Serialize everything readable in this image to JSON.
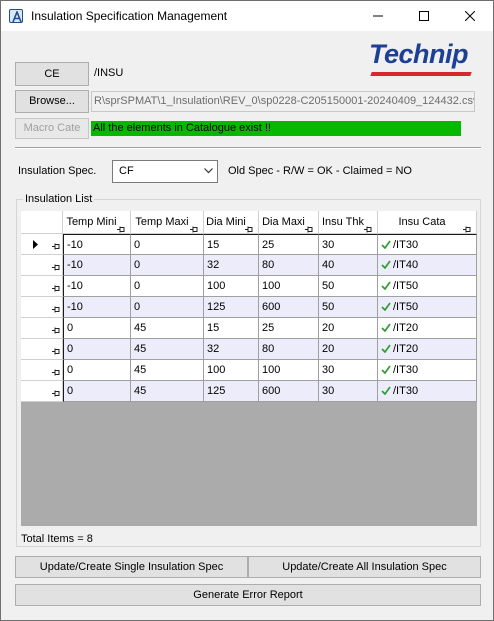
{
  "window": {
    "title": "Insulation Specification Management"
  },
  "buttons": {
    "ce": "CE",
    "browse": "Browse...",
    "macro": "Macro Cate",
    "update_single": "Update/Create Single Insulation Spec",
    "update_all": "Update/Create All Insulation Spec",
    "error_report": "Generate Error Report"
  },
  "ce_value": "/INSU",
  "file_path": "R\\sprSPMAT\\1_Insulation\\REV_0\\sp0228-C205150001-20240409_124432.csv",
  "status_message": "All the elements in Catalogue exist !!",
  "status_color": "#06b800",
  "logo_text": "Technip",
  "insulation_spec": {
    "label": "Insulation Spec.",
    "selected": "CF",
    "info": "Old Spec - R/W = OK - Claimed = NO"
  },
  "list": {
    "title": "Insulation List",
    "columns": [
      "Temp Mini",
      "Temp Maxi",
      "Dia Mini",
      "Dia Maxi",
      "Insu Thk",
      "Insu Cata"
    ],
    "rows": [
      [
        "-10",
        "0",
        "15",
        "25",
        "30",
        "/IT30"
      ],
      [
        "-10",
        "0",
        "32",
        "80",
        "40",
        "/IT40"
      ],
      [
        "-10",
        "0",
        "100",
        "100",
        "50",
        "/IT50"
      ],
      [
        "-10",
        "0",
        "125",
        "600",
        "50",
        "/IT50"
      ],
      [
        "0",
        "45",
        "15",
        "25",
        "20",
        "/IT20"
      ],
      [
        "0",
        "45",
        "32",
        "80",
        "20",
        "/IT20"
      ],
      [
        "0",
        "45",
        "100",
        "100",
        "30",
        "/IT30"
      ],
      [
        "0",
        "45",
        "125",
        "600",
        "30",
        "/IT30"
      ]
    ],
    "total": "Total Items = 8"
  }
}
